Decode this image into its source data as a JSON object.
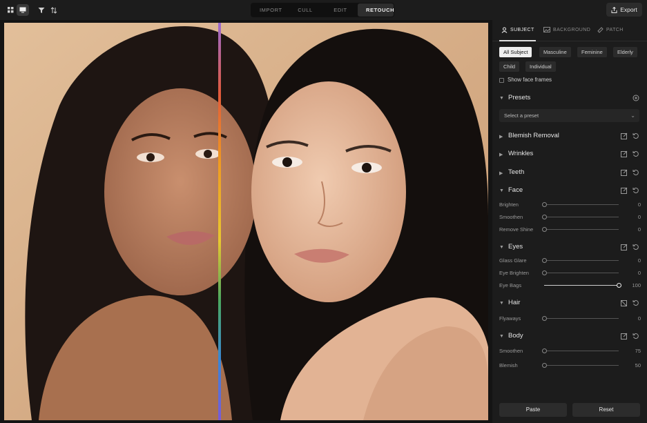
{
  "topbar": {
    "icons": [
      "grid-view-icon",
      "single-view-icon",
      "filter-icon",
      "sort-icon"
    ],
    "tabs": [
      "IMPORT",
      "CULL",
      "EDIT",
      "RETOUCH"
    ],
    "active_tab": "RETOUCH",
    "export_label": "Export"
  },
  "panel": {
    "tabs": [
      "SUBJECT",
      "BACKGROUND",
      "PATCH"
    ],
    "active_tab": "SUBJECT",
    "chips": [
      "All Subject",
      "Masculine",
      "Feminine",
      "Elderly",
      "Child",
      "Individual"
    ],
    "active_chip": "All Subject",
    "show_face_frames": "Show face frames",
    "presets": {
      "title": "Presets",
      "placeholder": "Select a preset"
    },
    "sections": {
      "blemish": "Blemish Removal",
      "wrinkles": "Wrinkles",
      "teeth": "Teeth",
      "face": "Face",
      "eyes": "Eyes",
      "hair": "Hair",
      "body": "Body"
    },
    "sliders": {
      "brighten": {
        "label": "Brighten",
        "value": "0",
        "level": 0
      },
      "smoothen_face": {
        "label": "Smoothen",
        "value": "0",
        "level": 0
      },
      "remove_shine": {
        "label": "Remove Shine",
        "value": "0",
        "level": 0
      },
      "glass_glare": {
        "label": "Glass Glare",
        "value": "0",
        "level": 0
      },
      "eye_brighten": {
        "label": "Eye Brighten",
        "value": "0",
        "level": 0
      },
      "eye_bags": {
        "label": "Eye Bags",
        "value": "100",
        "level": 100
      },
      "flyaways": {
        "label": "Flyaways",
        "value": "0",
        "level": 0
      },
      "smoothen_body": {
        "label": "Smoothen",
        "value": "75",
        "level": 0
      },
      "blemish": {
        "label": "Blemish",
        "value": "50",
        "level": 0
      }
    },
    "buttons": {
      "paste": "Paste",
      "reset": "Reset"
    }
  },
  "colors": {
    "background": "#141414",
    "panel": "#1c1c1c",
    "divider_gradient": [
      "#e85a3a",
      "#f0a020",
      "#f0d020",
      "#40b060",
      "#3a8ad8",
      "#7a5ad8"
    ]
  }
}
